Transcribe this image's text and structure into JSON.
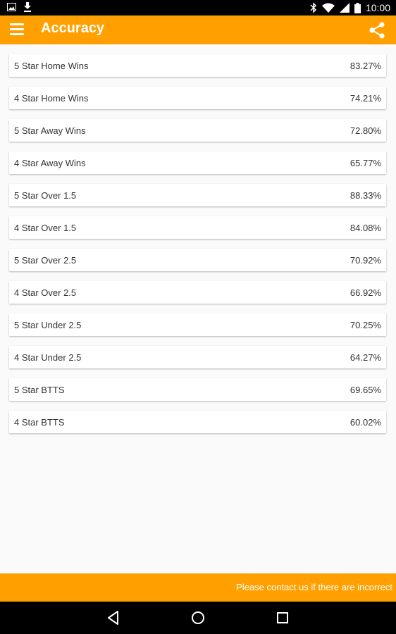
{
  "status_bar": {
    "time": "10:00",
    "icons": [
      "image-icon",
      "download-icon",
      "bluetooth-icon",
      "wifi-icon",
      "signal-icon",
      "battery-icon"
    ]
  },
  "app_bar": {
    "title": "Accuracy",
    "color": "#ffa000",
    "icons": [
      "menu-icon",
      "share-icon"
    ]
  },
  "accuracy": {
    "items": [
      {
        "label": "5 Star Home Wins",
        "value": "83.27%"
      },
      {
        "label": "4 Star Home Wins",
        "value": "74.21%"
      },
      {
        "label": "5 Star Away Wins",
        "value": "72.80%"
      },
      {
        "label": "4 Star Away Wins",
        "value": "65.77%"
      },
      {
        "label": "5 Star Over 1.5",
        "value": "88.33%"
      },
      {
        "label": "4 Star Over 1.5",
        "value": "84.08%"
      },
      {
        "label": "5 Star Over 2.5",
        "value": "70.92%"
      },
      {
        "label": "4 Star Over 2.5",
        "value": "66.92%"
      },
      {
        "label": "5 Star Under 2.5",
        "value": "70.25%"
      },
      {
        "label": "4 Star Under 2.5",
        "value": "64.27%"
      },
      {
        "label": "5 Star BTTS",
        "value": "69.65%"
      },
      {
        "label": "4 Star BTTS",
        "value": "60.02%"
      }
    ]
  },
  "footer": {
    "message": "Please contact us if there are incorrect"
  },
  "nav_bar": {
    "icons": [
      "back-icon",
      "home-icon",
      "recents-icon"
    ]
  }
}
